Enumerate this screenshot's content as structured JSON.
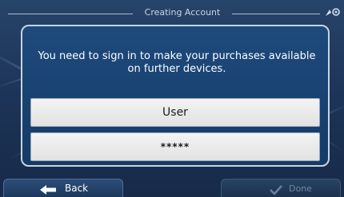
{
  "header": {
    "title": "Creating Account",
    "status_icon": "gps-signal-icon"
  },
  "dialog": {
    "message": "You need to sign in to make your purchases available on further devices.",
    "username_value": "User",
    "password_value": "*****"
  },
  "footer": {
    "back_label": "Back",
    "back_icon": "arrow-left-icon",
    "done_label": "Done",
    "done_icon": "checkmark-icon",
    "done_enabled": false
  },
  "colors": {
    "background": "#1d3559",
    "dialog": "#1e4a7c",
    "field": "#eeeeee",
    "text_light": "#ffffff",
    "disabled_text": "#7186a1"
  }
}
